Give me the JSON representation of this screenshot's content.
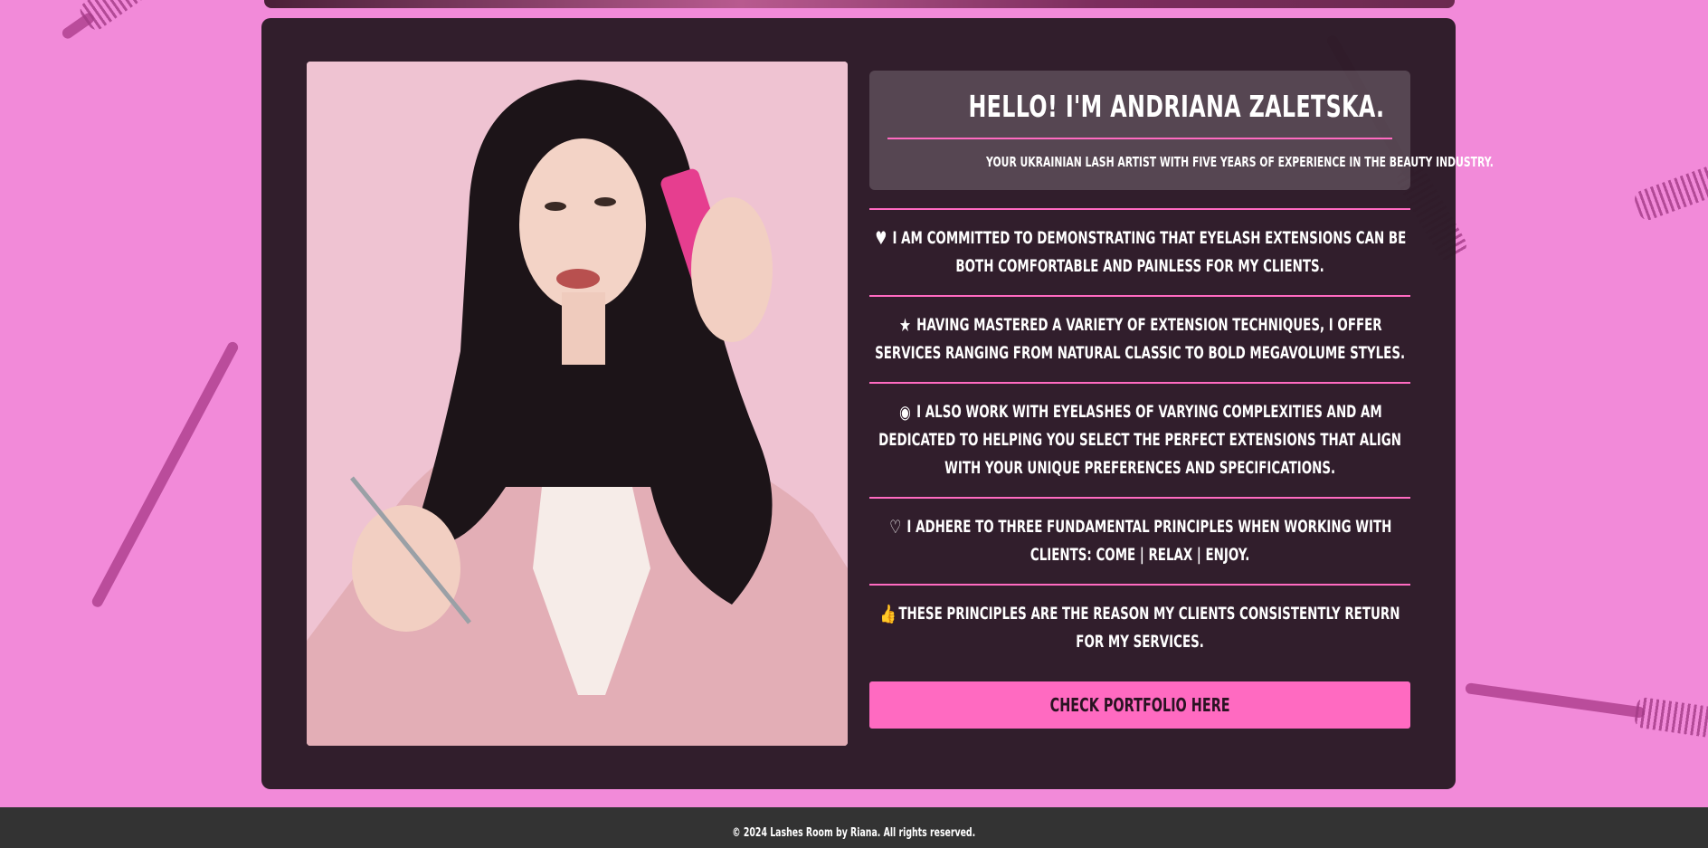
{
  "intro": {
    "heading": "Hello! I'm Andriana Zaletska.",
    "subheading": "Your Ukrainian lash artist with five years of experience in the beauty industry."
  },
  "points": [
    {
      "icon": "heart-solid-icon",
      "glyph": "♥",
      "text": "I am committed to demonstrating that eyelash extensions can be both comfortable and painless for my clients."
    },
    {
      "icon": "star-icon",
      "glyph": "★",
      "text": "Having mastered a variety of extension techniques, I offer services ranging from natural classic to bold megavolume styles."
    },
    {
      "icon": "eye-icon",
      "glyph": "◉",
      "text": "I also work with eyelashes of varying complexities and am dedicated to helping you select the perfect extensions that align with your unique preferences and specifications."
    },
    {
      "icon": "heart-outline-icon",
      "glyph": "♡",
      "text": "I adhere to three fundamental principles when working with clients: Come | Relax | Enjoy."
    },
    {
      "icon": "thumbs-up-icon",
      "glyph": "👍",
      "text": "These principles are the reason my clients consistently return for my services."
    }
  ],
  "cta": {
    "label": "Check Portfolio Here"
  },
  "footer": {
    "text": "© 2024 Lashes Room by Riana. All rights reserved."
  },
  "colors": {
    "accent": "#ff6ac1",
    "background": "#f28ad9",
    "card": "#2d1c28",
    "footer": "#333333"
  }
}
